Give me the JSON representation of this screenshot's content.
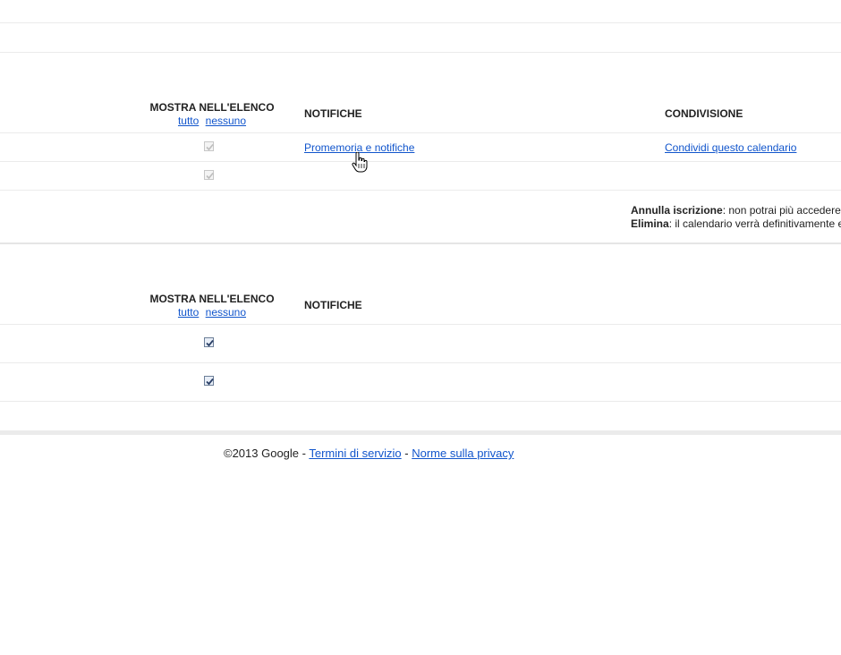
{
  "section1": {
    "show_header": "MOSTRA NELL'ELENCO",
    "select_all": "tutto",
    "select_none": "nessuno",
    "notifications_header": "NOTIFICHE",
    "sharing_header": "CONDIVISIONE",
    "rows": [
      {
        "checked": true,
        "disabled": true,
        "notifications_link": "Promemoria e notifiche",
        "share_link": "Condividi questo calendario"
      },
      {
        "checked": true,
        "disabled": true
      }
    ],
    "unsubscribe_label": "Annulla iscrizione",
    "unsubscribe_text": ": non potrai più accedere",
    "delete_label": "Elimina",
    "delete_text": ": il calendario verrà definitivamente e"
  },
  "section2": {
    "show_header": "MOSTRA NELL'ELENCO",
    "select_all": "tutto",
    "select_none": "nessuno",
    "notifications_header": "NOTIFICHE",
    "rows": [
      {
        "checked": true,
        "disabled": false
      },
      {
        "checked": true,
        "disabled": false
      }
    ]
  },
  "footer": {
    "copyright": "©2013 Google",
    "separator": " - ",
    "terms_link": "Termini di servizio",
    "privacy_link": "Norme sulla privacy"
  },
  "colors": {
    "link": "#1155cc",
    "divider": "#ebebeb",
    "text": "#222222"
  },
  "cursor_icon": "hand-pointer-icon"
}
